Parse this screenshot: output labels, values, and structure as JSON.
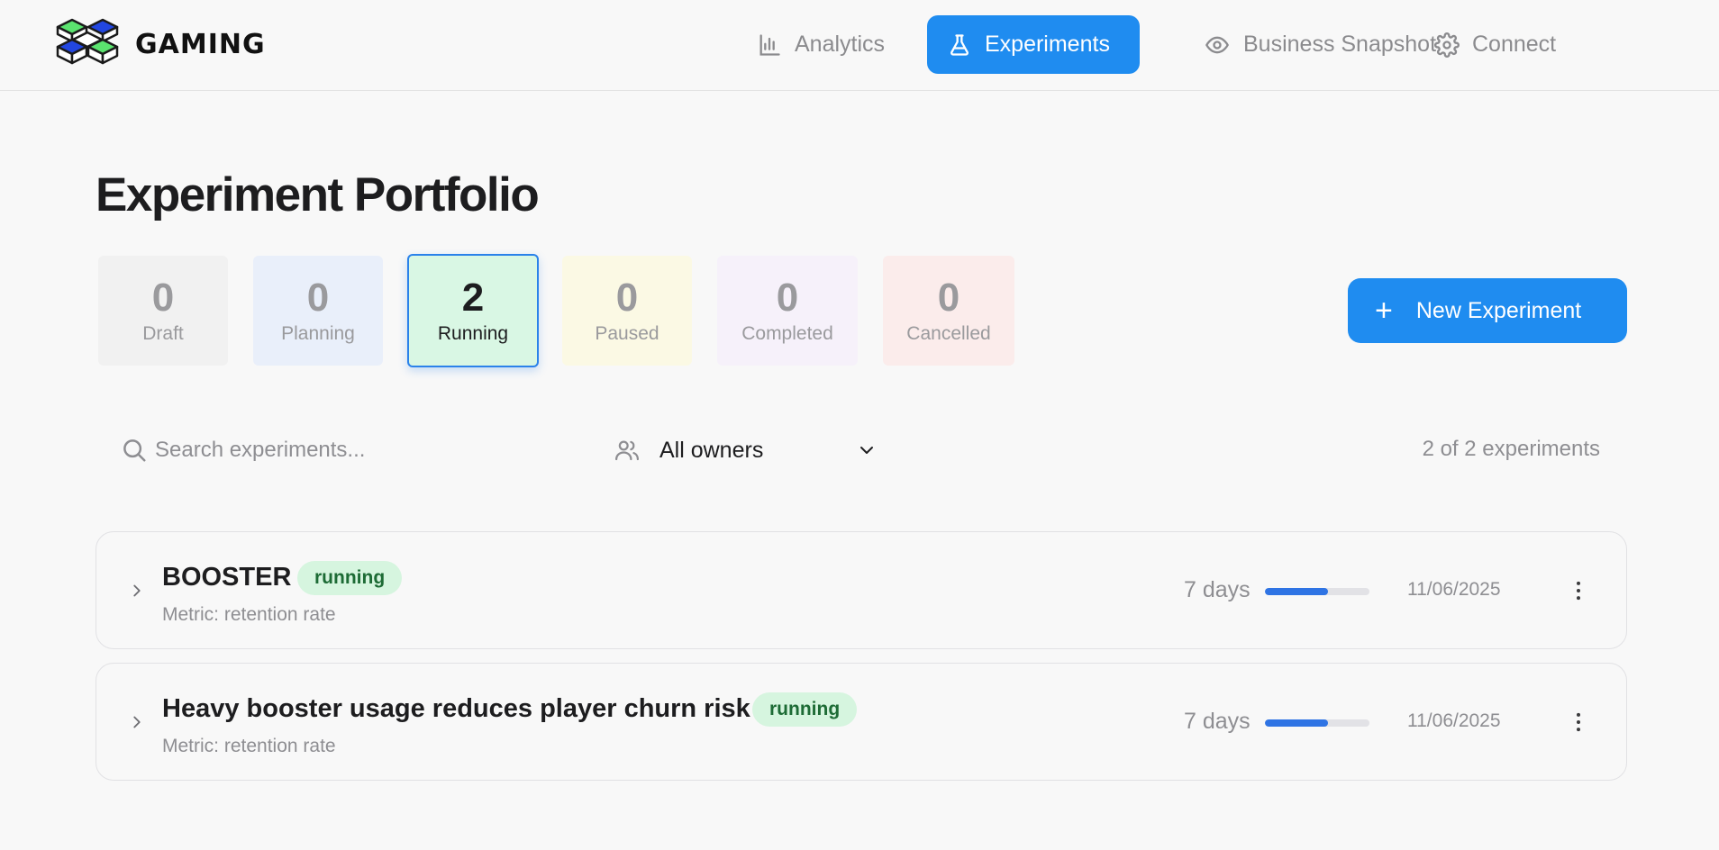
{
  "brand": {
    "name": "GAMING"
  },
  "nav": [
    {
      "label": "Analytics",
      "icon": "bar-chart-icon",
      "active": false
    },
    {
      "label": "Experiments",
      "icon": "flask-icon",
      "active": true
    },
    {
      "label": "Business Snapshot",
      "icon": "eye-icon",
      "active": false
    },
    {
      "label": "Connect",
      "icon": "gear-icon",
      "active": false
    }
  ],
  "page": {
    "title": "Experiment Portfolio"
  },
  "status_cards": [
    {
      "count": "0",
      "label": "Draft",
      "bg": "#f1f1f1",
      "active": false
    },
    {
      "count": "0",
      "label": "Planning",
      "bg": "#e9effa",
      "active": false
    },
    {
      "count": "2",
      "label": "Running",
      "bg": "#d9f7e4",
      "active": true
    },
    {
      "count": "0",
      "label": "Paused",
      "bg": "#fbf9e4",
      "active": false
    },
    {
      "count": "0",
      "label": "Completed",
      "bg": "#f6f1fa",
      "active": false
    },
    {
      "count": "0",
      "label": "Cancelled",
      "bg": "#fbeceb",
      "active": false
    }
  ],
  "new_button": {
    "label": "New Experiment",
    "icon": "plus-icon"
  },
  "filters": {
    "search_placeholder": "Search experiments...",
    "search_value": "",
    "owner_filter": "All owners",
    "result_count": "2 of 2 experiments"
  },
  "experiments": [
    {
      "name": "BOOSTER",
      "status": "running",
      "metric": "Metric: retention rate",
      "duration": "7 days",
      "progress": 0.6,
      "date": "11/06/2025"
    },
    {
      "name": "Heavy booster usage reduces player churn risk",
      "status": "running",
      "metric": "Metric: retention rate",
      "duration": "7 days",
      "progress": 0.6,
      "date": "11/06/2025"
    }
  ],
  "colors": {
    "accent": "#1f8cf0",
    "running_badge_bg": "#d6f5df",
    "running_badge_text": "#1d6b35",
    "progress_fill": "#2f74e4"
  }
}
